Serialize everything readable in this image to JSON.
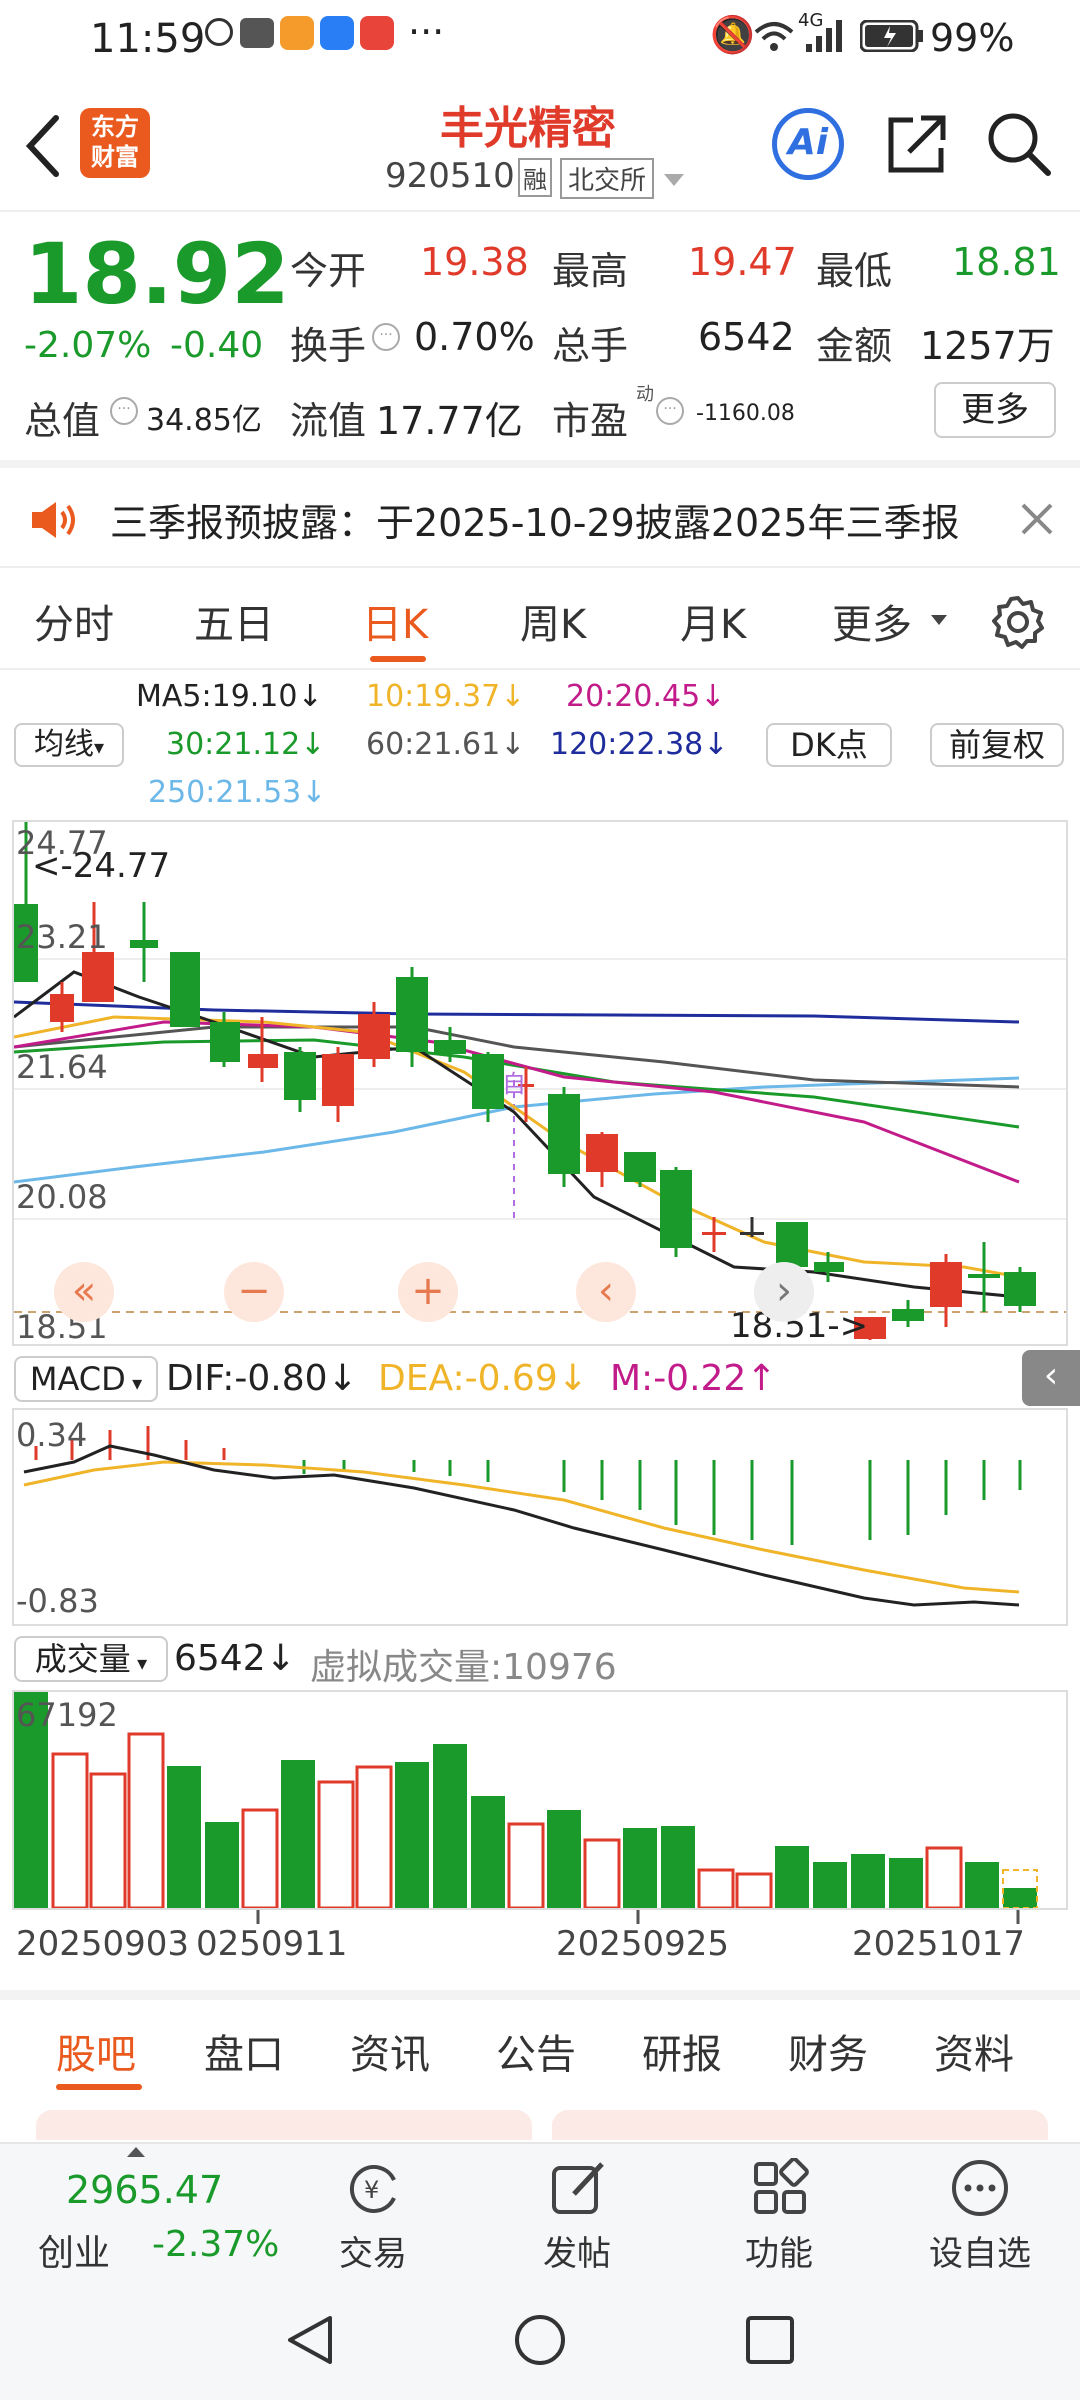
{
  "status": {
    "time": "11:59",
    "dots": "···",
    "network": "4G",
    "battery": "99%"
  },
  "header": {
    "logo_line1": "东方",
    "logo_line2": "财富",
    "stock_name": "丰光精密",
    "code": "920510",
    "badge_margin": "融",
    "exchange": "北交所",
    "ai_label": "Ai"
  },
  "quote": {
    "price": "18.92",
    "change_pct": "-2.07%",
    "change": "-0.40",
    "open_label": "今开",
    "open": "19.38",
    "high_label": "最高",
    "high": "19.47",
    "low_label": "最低",
    "low": "18.81",
    "turnover_label": "换手",
    "turnover": "0.70%",
    "volume_label": "总手",
    "volume": "6542",
    "amount_label": "金额",
    "amount": "1257万",
    "mktcap_label": "总值",
    "mktcap": "34.85亿",
    "float_label": "流值",
    "float": "17.77亿",
    "pe_label": "市盈",
    "pe_sup": "动",
    "pe": "-1160.08",
    "more": "更多"
  },
  "notice": {
    "text": "三季报预披露：于2025-10-29披露2025年三季报"
  },
  "chart_tabs": [
    "分时",
    "五日",
    "日K",
    "周K",
    "月K",
    "更多"
  ],
  "ma": {
    "selector": "均线",
    "ma5": "MA5:19.10↓",
    "ma10": "10:19.37↓",
    "ma20": "20:20.45↓",
    "ma30": "30:21.12↓",
    "ma60": "60:21.61↓",
    "ma120": "120:22.38↓",
    "ma250": "250:21.53↓",
    "dk": "DK点",
    "adjust": "前复权"
  },
  "kline": {
    "y_labels": [
      "24.77",
      "23.21",
      "21.64",
      "20.08",
      "18.51"
    ],
    "max_note": "<-24.77",
    "min_note": "18.51->",
    "marker": "自"
  },
  "macd": {
    "selector": "MACD",
    "dif": "DIF:-0.80↓",
    "dea": "DEA:-0.69↓",
    "m": "M:-0.22↑",
    "y_top": "0.34",
    "y_bottom": "-0.83"
  },
  "volume": {
    "selector": "成交量",
    "value": "6542↓",
    "virtual": "虚拟成交量:10976",
    "y_top": "67192"
  },
  "dates": [
    "20250903",
    "0250911",
    "20250925",
    "20251017"
  ],
  "bottom_tabs": [
    "股吧",
    "盘口",
    "资讯",
    "公告",
    "研报",
    "财务",
    "资料"
  ],
  "bottom_nav": {
    "index_value": "2965.47",
    "index_name": "创业",
    "index_change": "-2.37%",
    "trade": "交易",
    "post": "发帖",
    "features": "功能",
    "watch": "设自选"
  },
  "colors": {
    "up": "#e03a2b",
    "down": "#1a9a2a",
    "ma5": "#222222",
    "ma10": "#f0b429",
    "ma20": "#c21b8a",
    "ma30": "#1a9a2a",
    "ma60": "#555555",
    "ma120": "#1f2d9c",
    "ma250": "#6cb8e8"
  }
}
